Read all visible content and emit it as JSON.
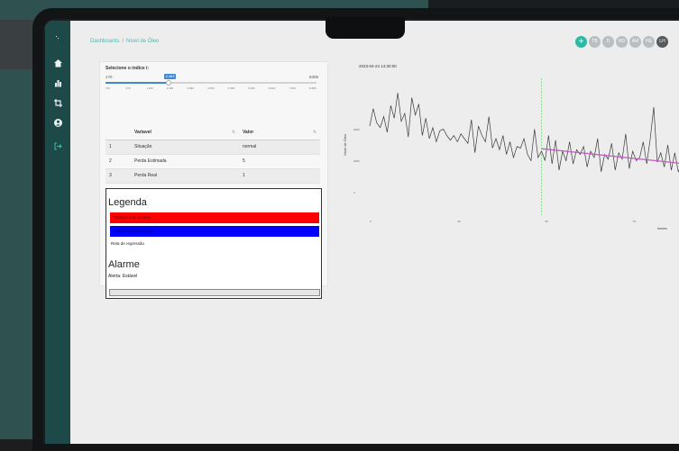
{
  "breadcrumb": {
    "root": "Dashboards",
    "separator": "/",
    "current": "Nível de Óleo"
  },
  "top_buttons": {
    "add": "+",
    "b1": "TB",
    "b2": "D",
    "b3": "HD",
    "b4": "AM",
    "b5": "HE",
    "b6": "LH"
  },
  "slider": {
    "label": "Selecione o índice i:",
    "min_label": "1?0",
    "max_label": "8305",
    "current": "4.463",
    "fill_fraction": 0.3,
    "ticks": [
      "176",
      "470",
      "1.163",
      "2.496",
      "3.690",
      "4.263",
      "5.400",
      "6.484",
      "6.916",
      "7.512",
      "8.305"
    ]
  },
  "table": {
    "headers": {
      "col1": "",
      "col2": "Variavel",
      "col3": "Valor"
    },
    "rows": [
      {
        "id": "1",
        "variavel": "Situação",
        "valor": "normal"
      },
      {
        "id": "2",
        "variavel": "Perda Estimada",
        "valor": "5"
      },
      {
        "id": "3",
        "variavel": "Perda Real",
        "valor": "1"
      }
    ]
  },
  "legend": {
    "title": "Legenda",
    "red_label": "Predições do modelo",
    "blue_label": "Dados reais do sensor",
    "plain_label": "Reta de regressão"
  },
  "alarm": {
    "title": "Alarme",
    "text": "Alerta: Estável"
  },
  "colors": {
    "sidebar": "#1d4948",
    "accent": "#2cb9a5",
    "red": "#ff0000",
    "blue": "#0000ff",
    "regression": "#c060c0",
    "vline": "#6fd66f"
  },
  "icons": {
    "menu": "menu-icon",
    "home": "home-icon",
    "chart": "bar-chart-icon",
    "crop": "crop-icon",
    "user": "user-icon",
    "logout": "logout-icon"
  },
  "chart_data": {
    "type": "line",
    "title": "2023-04-24 14:30:00",
    "xlabel": "frames",
    "ylabel": "Nível de Óleo",
    "x_ticks": [
      "0",
      "25",
      "50",
      "75"
    ],
    "y_ticks": [
      "2000",
      "1000",
      "0"
    ],
    "ylim": [
      -500,
      3500
    ],
    "xlim": [
      0,
      90
    ],
    "vline_x": 49,
    "grid": false,
    "series": [
      {
        "values": [
          2100,
          2650,
          2200,
          2050,
          2400,
          1900,
          2750,
          2350,
          3150,
          2250,
          2500,
          1750,
          3000,
          2450,
          2800,
          1800,
          2350,
          1700,
          2050,
          1600,
          1950,
          2000,
          1800,
          1650,
          1800,
          1600,
          1850,
          1700,
          1550,
          2300,
          1250,
          2100,
          1800,
          1600,
          2400,
          1400,
          1700,
          1350,
          1800,
          1200,
          1600,
          1100,
          1450,
          1400,
          1700,
          1200,
          1000,
          2000,
          1100,
          1300,
          1000,
          1800,
          900,
          1650,
          700,
          1300,
          1000,
          1600,
          900,
          1350,
          1200,
          1450,
          800,
          1300,
          1100,
          1700,
          650,
          1200,
          1050,
          1550,
          700,
          1250,
          1050,
          1850,
          750,
          1300,
          1000,
          1100,
          1600,
          900,
          1700,
          2700,
          950,
          1250,
          800,
          1500,
          700,
          1250,
          650,
          900,
          1100
        ]
      },
      {
        "values_x": [
          49,
          90
        ],
        "values": [
          1380,
          900
        ]
      }
    ]
  }
}
